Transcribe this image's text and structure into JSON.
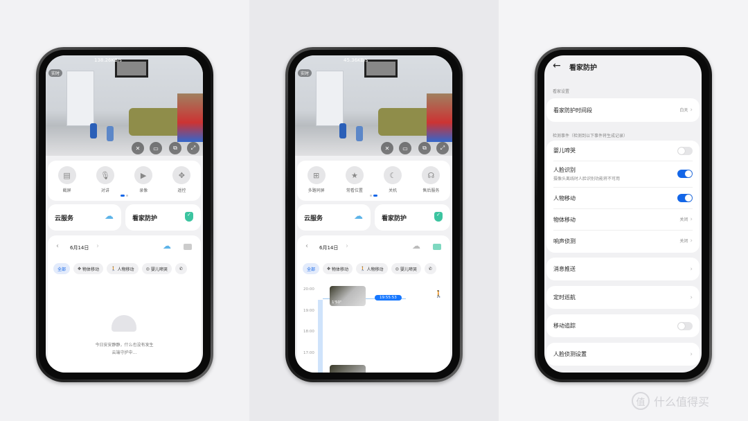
{
  "colors": {
    "accent": "#1366e8",
    "shield": "#3cc4a0",
    "cloud": "#5cb3e8"
  },
  "phone1": {
    "speed": "138.26KB/s",
    "live_label": "实时",
    "video_buttons": [
      "mute-icon",
      "hd-icon",
      "pip-icon",
      "fullscreen-icon"
    ],
    "controls": [
      {
        "label": "截屏",
        "icon": "screenshot-icon"
      },
      {
        "label": "对讲",
        "icon": "microphone-icon"
      },
      {
        "label": "录像",
        "icon": "video-icon"
      },
      {
        "label": "遥控",
        "icon": "remote-icon"
      }
    ],
    "page_index": 1,
    "page_count": 2,
    "cloud_service": "云服务",
    "home_guard": "看家防护",
    "date": "6月14日",
    "chips": [
      "全部",
      "物体移动",
      "人物移动",
      "婴儿啼哭"
    ],
    "empty_line1": "今日安安静静，什么也没有发生",
    "empty_line2": "云端守护中…"
  },
  "phone2": {
    "speed": "45.36KB/s",
    "live_label": "实时",
    "controls": [
      {
        "label": "多路同屏",
        "icon": "split-screen-icon"
      },
      {
        "label": "常看位置",
        "icon": "star-icon"
      },
      {
        "label": "关机",
        "icon": "moon-icon"
      },
      {
        "label": "售后服务",
        "icon": "headset-icon"
      }
    ],
    "page_index": 2,
    "page_count": 2,
    "cloud_service": "云服务",
    "home_guard": "看家防护",
    "date": "6月14日",
    "chips": [
      "全部",
      "物体移动",
      "人物移动",
      "婴儿啼哭"
    ],
    "timeline_ticks": [
      "20:00",
      "19:00",
      "18:00",
      "17:00"
    ],
    "clip_duration": "1'50\"",
    "current_time": "19:55:53"
  },
  "phone3": {
    "title": "看家防护",
    "section1": "看家设置",
    "period_label": "看家防护时间段",
    "period_value": "白天",
    "section2": "检测事件（检测到以下事件将生成记录）",
    "events": [
      {
        "label": "婴儿啼哭",
        "type": "toggle",
        "on": false
      },
      {
        "label": "人脸识别",
        "sub": "摄像头离线时人脸识别功能将不可用",
        "type": "toggle",
        "on": true
      },
      {
        "label": "人物移动",
        "type": "toggle",
        "on": true
      },
      {
        "label": "物体移动",
        "type": "link",
        "value": "关闭"
      },
      {
        "label": "响声侦测",
        "type": "link",
        "value": "关闭"
      }
    ],
    "push": "消息推送",
    "cruise": "定时巡航",
    "tracking": {
      "label": "移动追踪",
      "on": false
    },
    "face_settings": "人脸侦测设置"
  },
  "watermark": {
    "badge": "值",
    "text": "什么值得买"
  }
}
